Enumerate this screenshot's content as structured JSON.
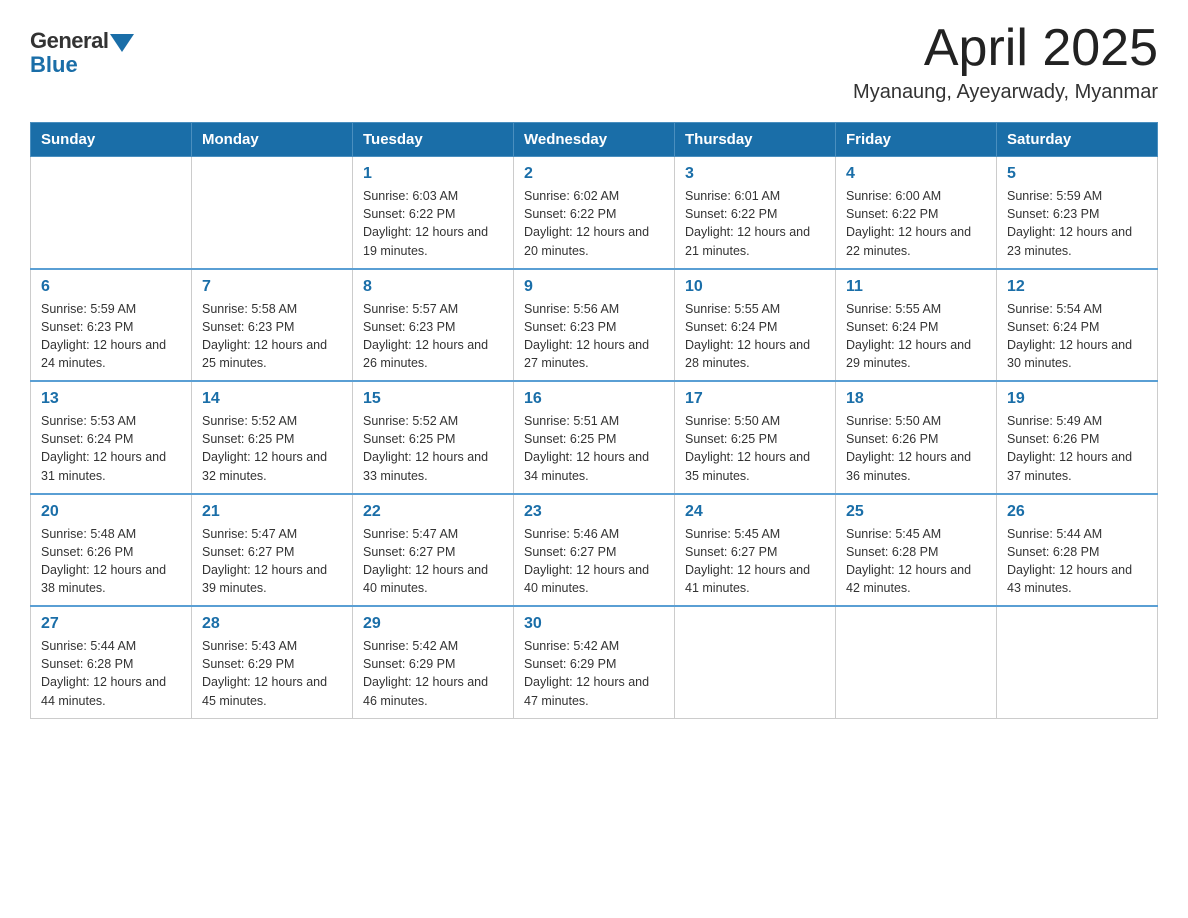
{
  "header": {
    "logo_general": "General",
    "logo_blue": "Blue",
    "month_year": "April 2025",
    "location": "Myanaung, Ayeyarwady, Myanmar"
  },
  "weekdays": [
    "Sunday",
    "Monday",
    "Tuesday",
    "Wednesday",
    "Thursday",
    "Friday",
    "Saturday"
  ],
  "weeks": [
    [
      {
        "day": "",
        "sunrise": "",
        "sunset": "",
        "daylight": ""
      },
      {
        "day": "",
        "sunrise": "",
        "sunset": "",
        "daylight": ""
      },
      {
        "day": "1",
        "sunrise": "Sunrise: 6:03 AM",
        "sunset": "Sunset: 6:22 PM",
        "daylight": "Daylight: 12 hours and 19 minutes."
      },
      {
        "day": "2",
        "sunrise": "Sunrise: 6:02 AM",
        "sunset": "Sunset: 6:22 PM",
        "daylight": "Daylight: 12 hours and 20 minutes."
      },
      {
        "day": "3",
        "sunrise": "Sunrise: 6:01 AM",
        "sunset": "Sunset: 6:22 PM",
        "daylight": "Daylight: 12 hours and 21 minutes."
      },
      {
        "day": "4",
        "sunrise": "Sunrise: 6:00 AM",
        "sunset": "Sunset: 6:22 PM",
        "daylight": "Daylight: 12 hours and 22 minutes."
      },
      {
        "day": "5",
        "sunrise": "Sunrise: 5:59 AM",
        "sunset": "Sunset: 6:23 PM",
        "daylight": "Daylight: 12 hours and 23 minutes."
      }
    ],
    [
      {
        "day": "6",
        "sunrise": "Sunrise: 5:59 AM",
        "sunset": "Sunset: 6:23 PM",
        "daylight": "Daylight: 12 hours and 24 minutes."
      },
      {
        "day": "7",
        "sunrise": "Sunrise: 5:58 AM",
        "sunset": "Sunset: 6:23 PM",
        "daylight": "Daylight: 12 hours and 25 minutes."
      },
      {
        "day": "8",
        "sunrise": "Sunrise: 5:57 AM",
        "sunset": "Sunset: 6:23 PM",
        "daylight": "Daylight: 12 hours and 26 minutes."
      },
      {
        "day": "9",
        "sunrise": "Sunrise: 5:56 AM",
        "sunset": "Sunset: 6:23 PM",
        "daylight": "Daylight: 12 hours and 27 minutes."
      },
      {
        "day": "10",
        "sunrise": "Sunrise: 5:55 AM",
        "sunset": "Sunset: 6:24 PM",
        "daylight": "Daylight: 12 hours and 28 minutes."
      },
      {
        "day": "11",
        "sunrise": "Sunrise: 5:55 AM",
        "sunset": "Sunset: 6:24 PM",
        "daylight": "Daylight: 12 hours and 29 minutes."
      },
      {
        "day": "12",
        "sunrise": "Sunrise: 5:54 AM",
        "sunset": "Sunset: 6:24 PM",
        "daylight": "Daylight: 12 hours and 30 minutes."
      }
    ],
    [
      {
        "day": "13",
        "sunrise": "Sunrise: 5:53 AM",
        "sunset": "Sunset: 6:24 PM",
        "daylight": "Daylight: 12 hours and 31 minutes."
      },
      {
        "day": "14",
        "sunrise": "Sunrise: 5:52 AM",
        "sunset": "Sunset: 6:25 PM",
        "daylight": "Daylight: 12 hours and 32 minutes."
      },
      {
        "day": "15",
        "sunrise": "Sunrise: 5:52 AM",
        "sunset": "Sunset: 6:25 PM",
        "daylight": "Daylight: 12 hours and 33 minutes."
      },
      {
        "day": "16",
        "sunrise": "Sunrise: 5:51 AM",
        "sunset": "Sunset: 6:25 PM",
        "daylight": "Daylight: 12 hours and 34 minutes."
      },
      {
        "day": "17",
        "sunrise": "Sunrise: 5:50 AM",
        "sunset": "Sunset: 6:25 PM",
        "daylight": "Daylight: 12 hours and 35 minutes."
      },
      {
        "day": "18",
        "sunrise": "Sunrise: 5:50 AM",
        "sunset": "Sunset: 6:26 PM",
        "daylight": "Daylight: 12 hours and 36 minutes."
      },
      {
        "day": "19",
        "sunrise": "Sunrise: 5:49 AM",
        "sunset": "Sunset: 6:26 PM",
        "daylight": "Daylight: 12 hours and 37 minutes."
      }
    ],
    [
      {
        "day": "20",
        "sunrise": "Sunrise: 5:48 AM",
        "sunset": "Sunset: 6:26 PM",
        "daylight": "Daylight: 12 hours and 38 minutes."
      },
      {
        "day": "21",
        "sunrise": "Sunrise: 5:47 AM",
        "sunset": "Sunset: 6:27 PM",
        "daylight": "Daylight: 12 hours and 39 minutes."
      },
      {
        "day": "22",
        "sunrise": "Sunrise: 5:47 AM",
        "sunset": "Sunset: 6:27 PM",
        "daylight": "Daylight: 12 hours and 40 minutes."
      },
      {
        "day": "23",
        "sunrise": "Sunrise: 5:46 AM",
        "sunset": "Sunset: 6:27 PM",
        "daylight": "Daylight: 12 hours and 40 minutes."
      },
      {
        "day": "24",
        "sunrise": "Sunrise: 5:45 AM",
        "sunset": "Sunset: 6:27 PM",
        "daylight": "Daylight: 12 hours and 41 minutes."
      },
      {
        "day": "25",
        "sunrise": "Sunrise: 5:45 AM",
        "sunset": "Sunset: 6:28 PM",
        "daylight": "Daylight: 12 hours and 42 minutes."
      },
      {
        "day": "26",
        "sunrise": "Sunrise: 5:44 AM",
        "sunset": "Sunset: 6:28 PM",
        "daylight": "Daylight: 12 hours and 43 minutes."
      }
    ],
    [
      {
        "day": "27",
        "sunrise": "Sunrise: 5:44 AM",
        "sunset": "Sunset: 6:28 PM",
        "daylight": "Daylight: 12 hours and 44 minutes."
      },
      {
        "day": "28",
        "sunrise": "Sunrise: 5:43 AM",
        "sunset": "Sunset: 6:29 PM",
        "daylight": "Daylight: 12 hours and 45 minutes."
      },
      {
        "day": "29",
        "sunrise": "Sunrise: 5:42 AM",
        "sunset": "Sunset: 6:29 PM",
        "daylight": "Daylight: 12 hours and 46 minutes."
      },
      {
        "day": "30",
        "sunrise": "Sunrise: 5:42 AM",
        "sunset": "Sunset: 6:29 PM",
        "daylight": "Daylight: 12 hours and 47 minutes."
      },
      {
        "day": "",
        "sunrise": "",
        "sunset": "",
        "daylight": ""
      },
      {
        "day": "",
        "sunrise": "",
        "sunset": "",
        "daylight": ""
      },
      {
        "day": "",
        "sunrise": "",
        "sunset": "",
        "daylight": ""
      }
    ]
  ]
}
